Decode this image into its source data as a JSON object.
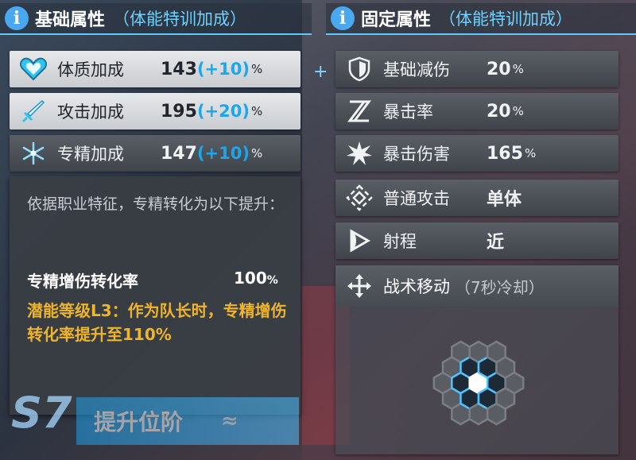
{
  "base_section": {
    "title": "基础属性",
    "subtitle": "（体能特训加成）",
    "rows": [
      {
        "label": "体质加成",
        "value": "143",
        "bonus": "(+10)",
        "unit": "%"
      },
      {
        "label": "攻击加成",
        "value": "195",
        "bonus": "(+20)",
        "unit": "%"
      },
      {
        "label": "专精加成",
        "value": "147",
        "bonus": "(+10)",
        "unit": "%"
      }
    ]
  },
  "fixed_section": {
    "title": "固定属性",
    "subtitle": "（体能特训加成）",
    "rows": [
      {
        "label": "基础减伤",
        "value": "20",
        "unit": "%"
      },
      {
        "label": "暴击率",
        "value": "20",
        "unit": "%"
      },
      {
        "label": "暴击伤害",
        "value": "165",
        "unit": "%"
      },
      {
        "label": "普通攻击",
        "value": "单体",
        "unit": ""
      },
      {
        "label": "射程",
        "value": "近",
        "unit": ""
      }
    ]
  },
  "tooltip": {
    "description": "依据职业特征，专精转化为以下提升：",
    "rate_label": "专精增伤转化率",
    "rate_value": "100",
    "rate_unit": "%",
    "potential": "潜能等级L3：作为队长时，专精增伤转化率提升至110%"
  },
  "tactical_move": {
    "label": "战术移动",
    "cooldown": "（7秒冷却）"
  },
  "level_badge": "S7",
  "promote_button": "提升位阶",
  "plus_mark": "+",
  "colors": {
    "accent_blue": "#1ca7ec",
    "potential_gold": "#f0b429",
    "light_row": "#e6e8ea",
    "dark_row": "#4a4f56"
  }
}
